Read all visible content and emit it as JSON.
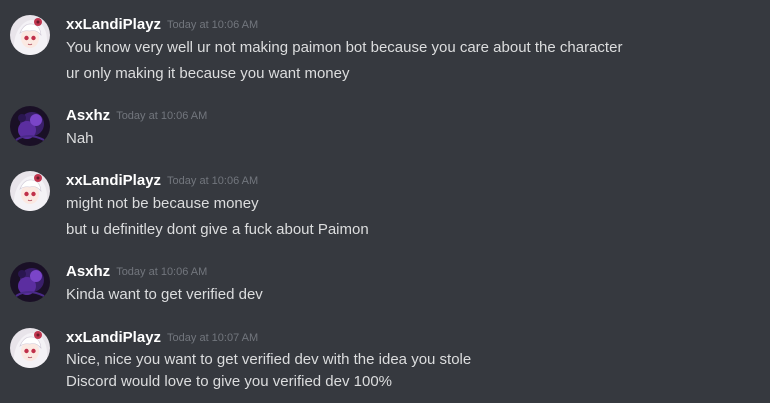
{
  "messages": [
    {
      "author": "xxLandiPlayz",
      "timestamp": "Today at 10:06 AM",
      "avatar": "anime-girl-avatar",
      "lines": [
        "You know very well ur not making paimon bot because you care about the character",
        "ur only making it because you want money"
      ]
    },
    {
      "author": "Asxhz",
      "timestamp": "Today at 10:06 AM",
      "avatar": "purple-dark-avatar",
      "lines": [
        "Nah"
      ]
    },
    {
      "author": "xxLandiPlayz",
      "timestamp": "Today at 10:06 AM",
      "avatar": "anime-girl-avatar",
      "lines": [
        "might not be because money",
        "but u definitley dont give a fuck about Paimon"
      ]
    },
    {
      "author": "Asxhz",
      "timestamp": "Today at 10:06 AM",
      "avatar": "purple-dark-avatar",
      "lines": [
        "Kinda want to get verified dev"
      ]
    },
    {
      "author": "xxLandiPlayz",
      "timestamp": "Today at 10:07 AM",
      "avatar": "anime-girl-avatar",
      "lines": [
        "Nice, nice you want to get verified dev with the idea you stole",
        "Discord would love to give you verified dev 100%"
      ]
    }
  ],
  "colors": {
    "background": "#36393f",
    "username": "#ffffff",
    "text": "#dcddde",
    "timestamp": "#72767d"
  }
}
